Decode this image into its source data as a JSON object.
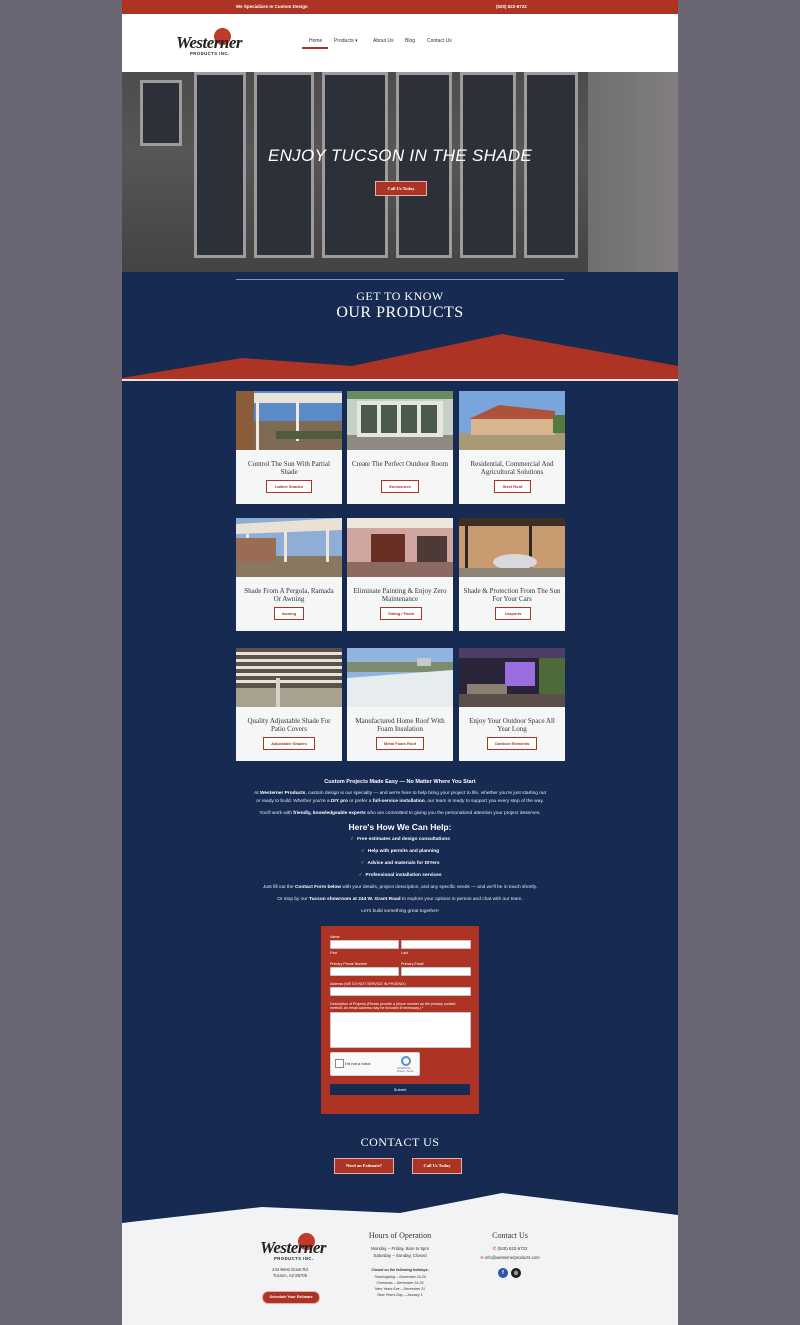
{
  "topbar": {
    "tagline": "We Specializes In Custom Design",
    "phone": "(520) 622-6722"
  },
  "logo": {
    "name": "Westerner",
    "sub": "PRODUCTS INC."
  },
  "nav": {
    "home": "Home",
    "products": "Products",
    "products_caret": "▾",
    "about": "About Us",
    "blog": "Blog",
    "contact": "Contact Us"
  },
  "hero": {
    "title": "ENJOY TUCSON IN THE SHADE",
    "cta": "Call Us Today"
  },
  "products_heading": {
    "line1": "GET TO KNOW",
    "line2": "OUR PRODUCTS"
  },
  "cards": [
    {
      "title": "Control The Sun With Partial Shade",
      "button": "Lattice Shades"
    },
    {
      "title": "Create The Perfect Outdoor Room",
      "button": "Enclosures"
    },
    {
      "title": "Residential, Commercial And Agricultural Solutions",
      "button": "Steel Roof"
    },
    {
      "title": "Shade From A Pergola, Ramada Or Awning",
      "button": "Awning"
    },
    {
      "title": "Eliminate Painting & Enjoy Zero Maintenance",
      "button": "Siding / Facia"
    },
    {
      "title": "Shade & Protection From The Sun For Your Cars",
      "button": "Carports"
    },
    {
      "title": "Quality Adjustable Shade For Patio Covers",
      "button": "Adjustable Shades"
    },
    {
      "title": "Manufactured Home Roof With Foam Insulation",
      "button": "Metal Foam Roof"
    },
    {
      "title": "Enjoy Your Outdoor Space All Year Long",
      "button": "Outdoor Elements"
    }
  ],
  "intro": {
    "heading": "Custom Projects Made Easy — No Matter Where You Start",
    "p1_pre": "At ",
    "p1_brand": "Westerner Products",
    "p1_mid": ", custom design is our specialty — and we're here to help bring your project to life, whether you're just starting out",
    "p1_line2_pre": "or ready to build. Whether you're a ",
    "p1_diy": "DIY pro",
    "p1_or": " or prefer a ",
    "p1_full": "full-service installation",
    "p1_end": ", our team is ready to support you every step of the way.",
    "p2_pre": "You'll work with ",
    "p2_bold": "friendly, knowledgeable experts",
    "p2_end": " who are committed to giving you the personalized attention your project deserves.",
    "help_heading": "Here's How We Can Help:",
    "checks": [
      "Free estimates and design consultations",
      "Help with permits and planning",
      "Advice and materials for DIYers",
      "Professional installation services"
    ],
    "check_mark": "✓",
    "p3_pre": "Just fill out the ",
    "p3_bold": "Contact Form below",
    "p3_end": " with your details, project description, and any specific needs — and we'll be in touch shortly.",
    "p4_pre": "Or stop by our ",
    "p4_bold": "Tucson showroom at 244 W. Grant Road",
    "p4_end": " to explore your options in person and chat with our team.",
    "p5": "Let's build something great together!"
  },
  "form": {
    "name_label": "Name",
    "first_label": "First",
    "last_label": "Last",
    "phone_label": "Primary Phone Number",
    "email_label": "Primary Email",
    "address_label": "Address (WE DO NOT SERVICE IN PHOENIX)",
    "desc_label": "Description of Projects (Please provide a phone number as the primary contact method. An email address may be included if necessary.) *",
    "captcha_label": "I'm not a robot",
    "captcha_brand": "reCAPTCHA",
    "captcha_terms": "Privacy - Terms",
    "submit": "Submit"
  },
  "contact": {
    "heading": "CONTACT US",
    "estimate": "Need an Estimate?",
    "call": "Call Us Today"
  },
  "footer": {
    "address1": "244 West Grant Rd",
    "address2": "Tucson, AZ 85705",
    "schedule": "Schedule Your Estimate",
    "hours_heading": "Hours of Operation",
    "hours1": "Monday – Friday, 8am to 5pm",
    "hours2": "Saturday – Sunday, Closed",
    "closed_heading": "Closed on the following holidays:",
    "holidays": [
      "Thanksgiving – November 24-26",
      "Christmas – December 24-26",
      "New Years Eve – December 31",
      "New Year's Day – January 1"
    ],
    "contact_heading": "Contact Us",
    "phone": "(520) 622-6722",
    "email": "info@westernerproducts.com",
    "phone_icon": "✆",
    "email_icon": "✉",
    "facebook": "f",
    "instagram": "◎"
  },
  "colors": {
    "accent": "#ad3424",
    "navy": "#172a52",
    "footer_bg": "#f2f3f5"
  }
}
